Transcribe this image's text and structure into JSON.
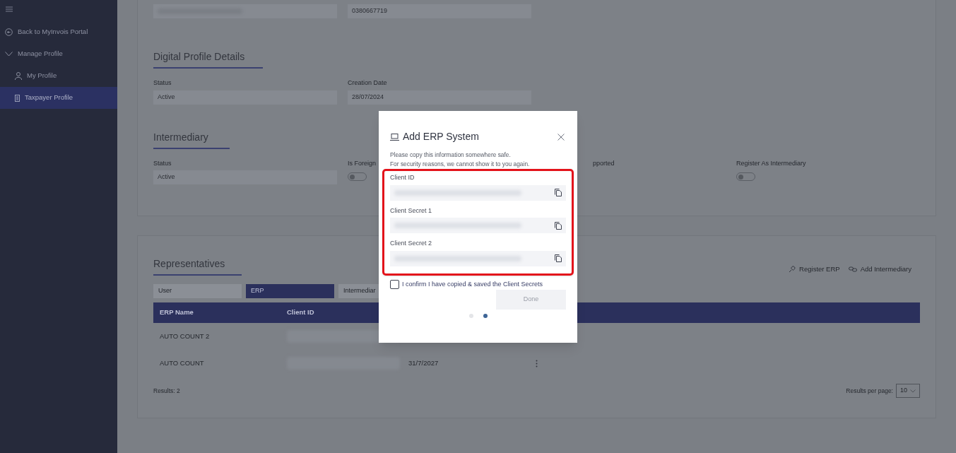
{
  "sidebar": {
    "items": [
      {
        "label": "Back to MyInvois Portal",
        "kind": "back",
        "selected": false
      },
      {
        "label": "Manage Profile",
        "kind": "group",
        "expanded": true,
        "selected": false,
        "children": [
          {
            "label": "My Profile",
            "kind": "person",
            "selected": false
          },
          {
            "label": "Taxpayer Profile",
            "kind": "building",
            "selected": true
          }
        ]
      }
    ]
  },
  "contact": {
    "fields": [
      {
        "blurred": true
      },
      {
        "value": "0380667719"
      }
    ]
  },
  "digital_profile": {
    "title": "Digital Profile Details",
    "fields": [
      {
        "label": "Status",
        "value": "Active"
      },
      {
        "label": "Creation Date",
        "value": "28/07/2024"
      }
    ]
  },
  "intermediary": {
    "title": "Intermediary",
    "fields": [
      {
        "label": "Status",
        "kind": "text",
        "value": "Active"
      },
      {
        "label": "Is Foreign",
        "kind": "toggle",
        "on": false
      },
      {
        "label": "pported",
        "kind": "label"
      },
      {
        "label": "Register As Intermediary",
        "kind": "toggle",
        "on": false
      }
    ]
  },
  "representatives": {
    "title": "Representatives",
    "actions": [
      {
        "label": "Register ERP",
        "kind": "erp"
      },
      {
        "label": "Add Intermediary",
        "kind": "link"
      }
    ],
    "tabs": [
      {
        "label": "User",
        "selected": false
      },
      {
        "label": "ERP",
        "selected": true
      },
      {
        "label": "Intermediar",
        "selected": false
      }
    ],
    "columns": [
      "ERP Name",
      "Client ID"
    ],
    "rows": [
      {
        "cells": [
          "AUTO COUNT 2",
          "",
          ""
        ]
      },
      {
        "cells": [
          "AUTO COUNT",
          "",
          "31/7/2027"
        ],
        "menu": true
      }
    ],
    "results": "Results: 2",
    "per_page_label": "Results per page:",
    "per_page": "10"
  },
  "dialog": {
    "title": "Add ERP System",
    "message": "Please copy this information somewhere safe.\nFor security reasons, we cannot show it to you again.",
    "fields": [
      {
        "label": "Client ID"
      },
      {
        "label": "Client Secret 1"
      },
      {
        "label": "Client Secret 2"
      }
    ],
    "confirm": {
      "label": "I confirm I have copied & saved the Client Secrets",
      "checked": false
    },
    "done": {
      "label": "Done",
      "disabled": true
    },
    "steps": [
      {
        "selected": false
      },
      {
        "selected": true
      }
    ]
  }
}
